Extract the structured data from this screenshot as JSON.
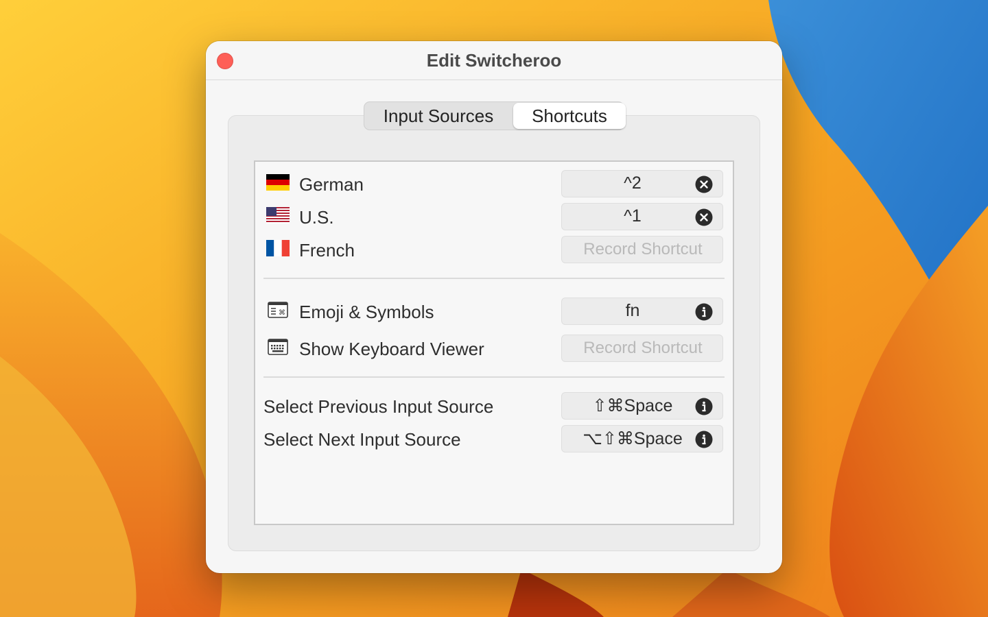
{
  "window": {
    "title": "Edit Switcheroo"
  },
  "tabs": [
    {
      "label": "Input Sources",
      "selected": false
    },
    {
      "label": "Shortcuts",
      "selected": true
    }
  ],
  "input_sources": [
    {
      "label": "German",
      "icon": "german-flag-icon",
      "shortcut": "^2",
      "action": "clear"
    },
    {
      "label": "U.S.",
      "icon": "us-flag-icon",
      "shortcut": "^1",
      "action": "clear"
    },
    {
      "label": "French",
      "icon": "french-flag-icon",
      "placeholder": "Record Shortcut"
    }
  ],
  "tools": [
    {
      "label": "Emoji & Symbols",
      "icon": "emoji-symbols-icon",
      "shortcut": "fn",
      "action": "info"
    },
    {
      "label": "Show Keyboard Viewer",
      "icon": "keyboard-viewer-icon",
      "placeholder": "Record Shortcut"
    }
  ],
  "system": [
    {
      "label": "Select Previous Input Source",
      "shortcut": "⇧⌘Space",
      "action": "info"
    },
    {
      "label": "Select Next Input Source",
      "shortcut": "⌥⇧⌘Space",
      "action": "info"
    }
  ],
  "colors": {
    "close_button": "#fe5f57",
    "window_background": "#f6f6f6",
    "selected_tab": "#ffffff"
  }
}
